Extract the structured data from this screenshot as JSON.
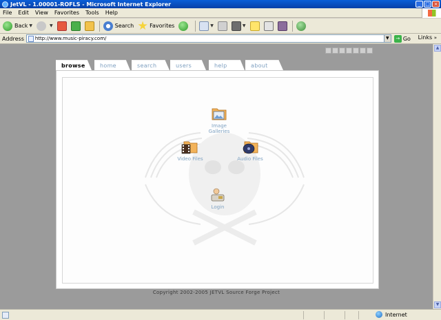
{
  "window": {
    "title": "JetVL - 1.00001-ROFLS - Microsoft Internet Explorer"
  },
  "menu": [
    "File",
    "Edit",
    "View",
    "Favorites",
    "Tools",
    "Help"
  ],
  "toolbar": {
    "back_label": "Back",
    "search_label": "Search",
    "favorites_label": "Favorites"
  },
  "address": {
    "label": "Address",
    "url": "http://www.music-piracy.com/",
    "go_label": "Go",
    "links_label": "Links"
  },
  "tabs": [
    {
      "label": "browse",
      "active": true
    },
    {
      "label": "home"
    },
    {
      "label": "search"
    },
    {
      "label": "users"
    },
    {
      "label": "help"
    },
    {
      "label": "about"
    }
  ],
  "items": {
    "image_galleries": {
      "line1": "Image",
      "line2": "Galleries"
    },
    "video_files": "Video Files",
    "audio_files": "Audio Files",
    "login": "Login"
  },
  "footer": {
    "copyright": "Copyright 2002-2005 JETVL Source Forge Project"
  },
  "status": {
    "zone": "Internet"
  },
  "colors": {
    "tab_text": "#7d9fc0",
    "page_bg": "#9b9b9b",
    "link_text": "#7fa2c2"
  }
}
